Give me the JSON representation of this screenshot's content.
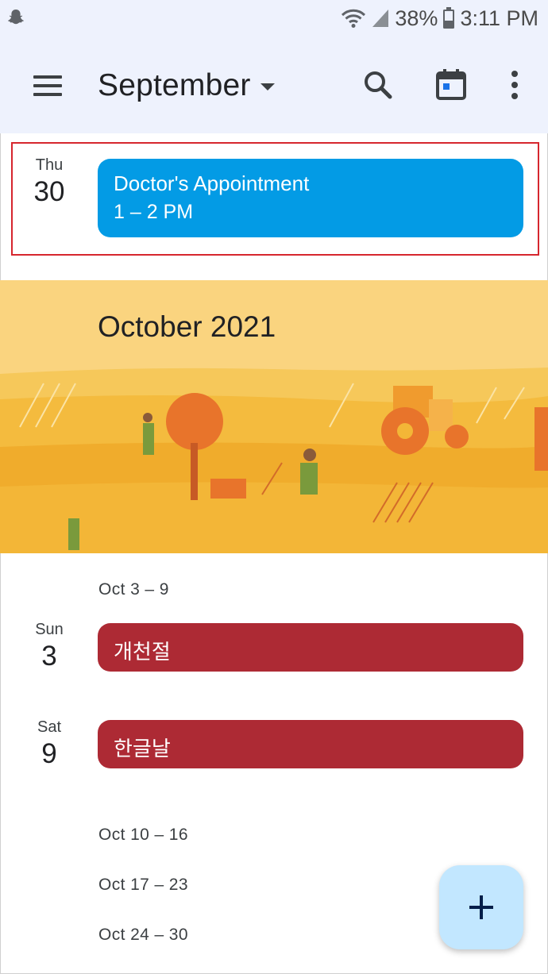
{
  "status_bar": {
    "battery": "38%",
    "time": "3:11 PM",
    "icons": [
      "snapchat-ghost-icon",
      "wifi-icon",
      "signal-icon",
      "battery-icon"
    ]
  },
  "app_bar": {
    "month_title": "September",
    "icons": [
      "menu-icon",
      "search-icon",
      "today-calendar-icon",
      "more-vert-icon"
    ]
  },
  "selected_event": {
    "dow": "Thu",
    "day": "30",
    "title": "Doctor's Appointment",
    "time": "1 – 2 PM",
    "color": "#039be5"
  },
  "banner": {
    "title": "October 2021",
    "theme_color": "#f9d27b"
  },
  "schedule": {
    "week1": "Oct 3 – 9",
    "events": [
      {
        "dow": "Sun",
        "day": "3",
        "title": "개천절",
        "color": "#ad2a34"
      },
      {
        "dow": "Sat",
        "day": "9",
        "title": "한글날",
        "color": "#ad2a34"
      }
    ],
    "weeks": [
      "Oct 10 – 16",
      "Oct 17 – 23",
      "Oct 24 – 30"
    ]
  },
  "fab": {
    "icon": "plus-icon",
    "color": "#c2e7ff"
  }
}
